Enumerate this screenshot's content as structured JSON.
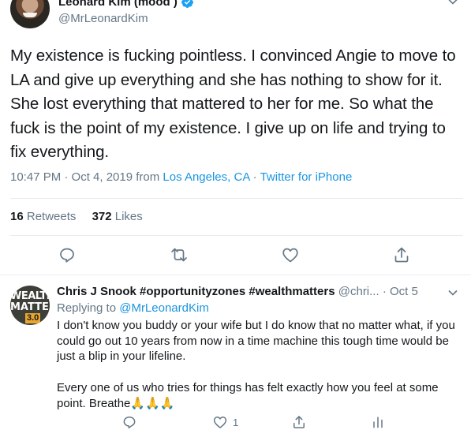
{
  "main_tweet": {
    "display_name": "Leonard Kim (mood )",
    "handle": "@MrLeonardKim",
    "text": "My existence is fucking pointless. I convinced Angie to move to LA and give up everything and she has nothing to show for it. She lost everything that mattered to her for me. So what the fuck is the point of my existence. I give up on life and trying to fix everything.",
    "time": "10:47 PM · Oct 4, 2019 from ",
    "location": "Los Angeles, CA",
    "separator": " · ",
    "source": "Twitter for iPhone",
    "retweets_count": "16",
    "retweets_label": " Retweets",
    "likes_count": "372",
    "likes_label": " Likes",
    "icons": [
      "reply-icon",
      "retweet-icon",
      "like-icon",
      "share-icon"
    ]
  },
  "reply": {
    "avatar_text_1": "WEALTH",
    "avatar_text_2": "MATTERS",
    "avatar_text_3": "3.0",
    "display_name": "Chris J Snook #opportunityzones #wealthmatters",
    "handle": " @chri...",
    "dot": " · ",
    "time": "Oct 5",
    "replying_prefix": "Replying to ",
    "replying_to": "@MrLeonardKim",
    "paragraph_1": "I don't know you buddy or your wife but I do know that no matter what, if you could go out 10 years from now in a time machine this tough time would be just a blip in your lifeline.",
    "paragraph_2": "Every one of us who tries for things has felt exactly how you feel at some point. Breathe",
    "emoji": "🙏🙏🙏",
    "likes_count": "1",
    "icons": [
      "reply-icon",
      "retweet-icon",
      "like-icon",
      "share-icon",
      "analytics-icon"
    ]
  },
  "colors": {
    "text": "#14171a",
    "secondary": "#657786",
    "link": "#1b95e0",
    "divider": "#e6ecf0"
  }
}
